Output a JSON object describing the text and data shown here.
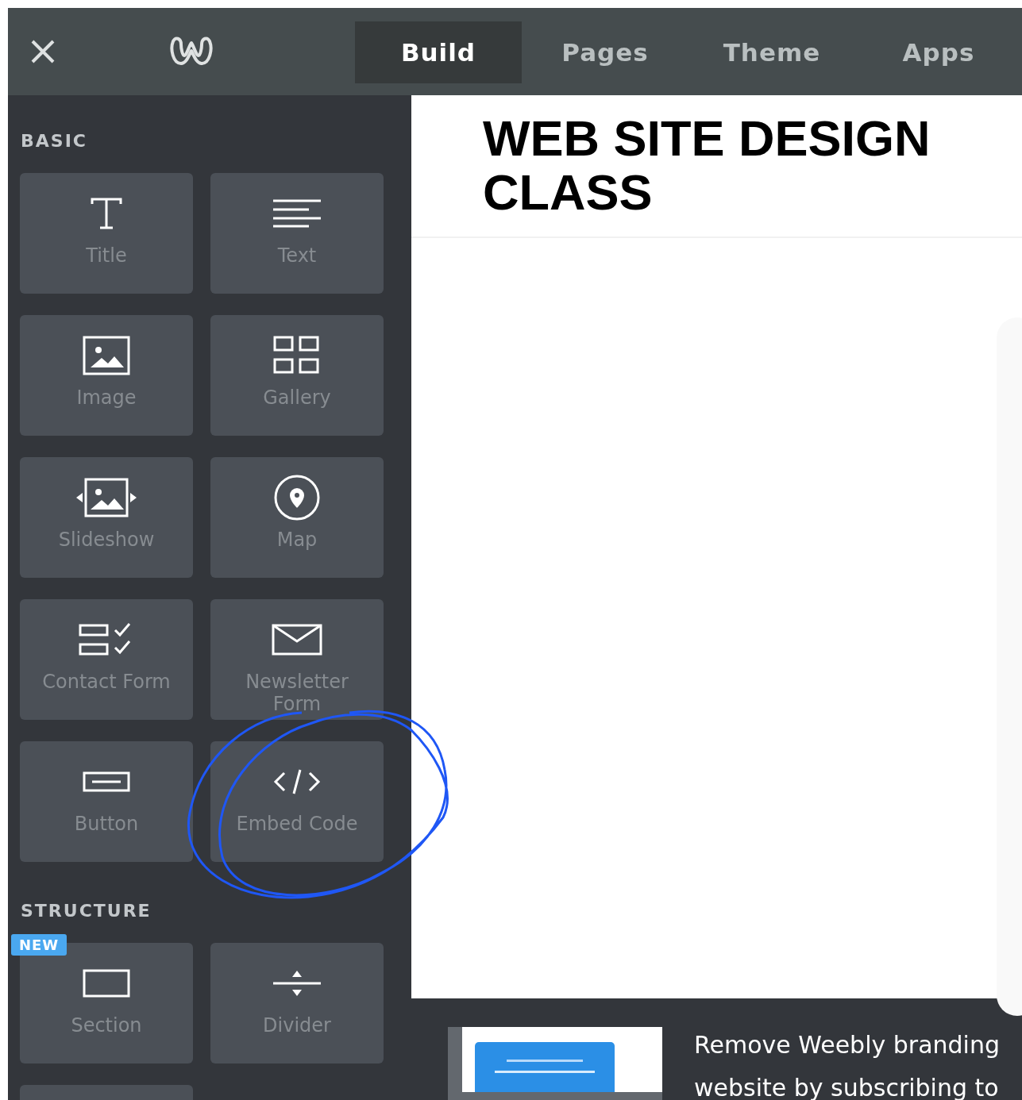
{
  "top_bar": {
    "tabs": [
      {
        "label": "Build",
        "selected": true
      },
      {
        "label": "Pages",
        "selected": false
      },
      {
        "label": "Theme",
        "selected": false
      },
      {
        "label": "Apps",
        "selected": false
      }
    ]
  },
  "sidebar": {
    "sections": [
      {
        "title": "BASIC",
        "items": [
          {
            "label": "Title",
            "kind": "title"
          },
          {
            "label": "Text",
            "kind": "text"
          },
          {
            "label": "Image",
            "kind": "image"
          },
          {
            "label": "Gallery",
            "kind": "gallery"
          },
          {
            "label": "Slideshow",
            "kind": "slideshow"
          },
          {
            "label": "Map",
            "kind": "map"
          },
          {
            "label": "Contact Form",
            "kind": "form"
          },
          {
            "label": "Newsletter Form",
            "kind": "newsletter"
          },
          {
            "label": "Button",
            "kind": "button"
          },
          {
            "label": "Embed Code",
            "kind": "code"
          }
        ]
      },
      {
        "title": "STRUCTURE",
        "items": [
          {
            "label": "Section",
            "kind": "section",
            "badge": "NEW"
          },
          {
            "label": "Divider",
            "kind": "divider"
          }
        ]
      }
    ]
  },
  "page": {
    "title": "WEB SITE DESIGN CLASS"
  },
  "banner": {
    "lines": [
      "Remove Weebly branding",
      "website by subscribing to"
    ]
  }
}
